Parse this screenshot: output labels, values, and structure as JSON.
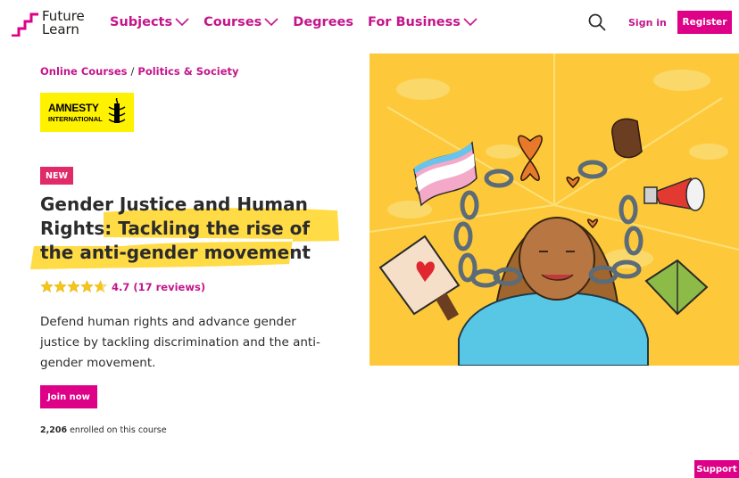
{
  "header": {
    "logo_line1": "Future",
    "logo_line2": "Learn",
    "nav": [
      {
        "label": "Subjects",
        "has_dropdown": true
      },
      {
        "label": "Courses",
        "has_dropdown": true
      },
      {
        "label": "Degrees",
        "has_dropdown": false
      },
      {
        "label": "For Business",
        "has_dropdown": true
      }
    ],
    "search_icon": "search-icon",
    "signin_label": "Sign in",
    "register_label": "Register"
  },
  "breadcrumb": {
    "items": [
      "Online Courses",
      "Politics & Society"
    ],
    "separator": "/"
  },
  "partner": {
    "line1": "AMNESTY",
    "line2": "INTERNATIONAL",
    "icon": "candle-barbed-wire-icon",
    "color": "#fff200"
  },
  "course": {
    "badge": "NEW",
    "title_part1": "Gender Justice and Human Rights: ",
    "title_part2": "Tackling the rise of the anti-gender movement",
    "rating_value": 4.7,
    "rating_text": "4.7 (17 reviews)",
    "description": "Defend human rights and advance gender justice by tackling discrimination and the anti-gender movement.",
    "join_label": "Join now",
    "enrolled_count": "2,206",
    "enrolled_suffix": " enrolled on this course"
  },
  "hero": {
    "description_icon": "course-illustration"
  },
  "support_label": "Support",
  "colors": {
    "brand": "#de0087",
    "link": "#c4158b",
    "badge": "#e02a6a",
    "highlight": "#ffd731",
    "hero_bg": "#fdc93a"
  }
}
